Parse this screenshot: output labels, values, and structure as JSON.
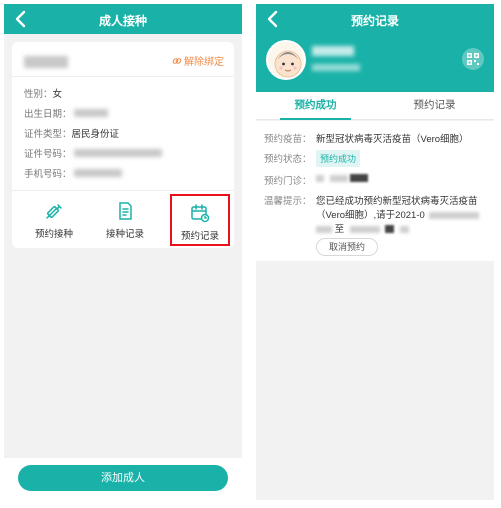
{
  "left": {
    "title": "成人接种",
    "unbind_label": "解除绑定",
    "fields": {
      "gender_label": "性别：",
      "gender_value": "女",
      "birth_label": "出生日期：",
      "id_type_label": "证件类型：",
      "id_type_value": "居民身份证",
      "id_number_label": "证件号码：",
      "phone_label": "手机号码："
    },
    "actions": [
      {
        "label": "预约接种",
        "icon": "syringe-icon"
      },
      {
        "label": "接种记录",
        "icon": "document-record-icon"
      },
      {
        "label": "预约记录",
        "icon": "calendar-clock-icon"
      }
    ],
    "add_button": "添加成人"
  },
  "right": {
    "title": "预约记录",
    "tabs": [
      "预约成功",
      "预约记录"
    ],
    "rows": {
      "vaccine_label": "预约疫苗：",
      "vaccine_value": "新型冠状病毒灭活疫苗（Vero细胞）",
      "status_label": "预约状态：",
      "status_value": "预约成功",
      "clinic_label": "预约门诊：",
      "tip_label": "温馨提示：",
      "tip_line1": "您已经成功预约新型冠状病毒灭活疫苗",
      "tip_line2": "（Vero细胞）,请于2021-0",
      "tip_line3_mid": "至"
    },
    "cancel_button": "取消预约"
  },
  "colors": {
    "primary": "#1ab2a8",
    "unbind": "#f08c4a",
    "highlight": "#e8121e"
  }
}
